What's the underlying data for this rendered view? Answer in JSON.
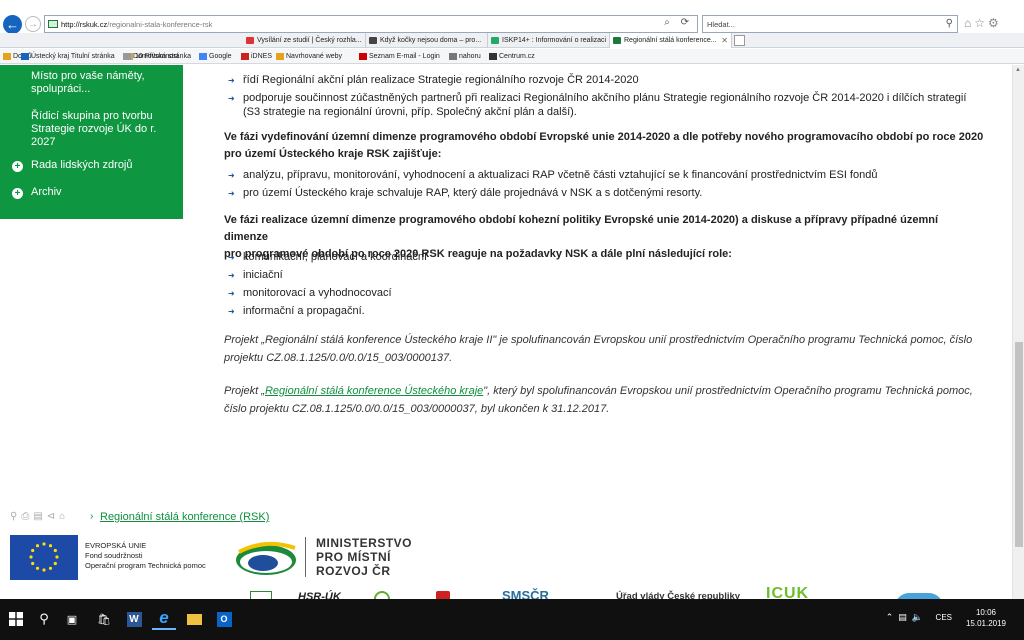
{
  "browser": {
    "url_host": "http://rskuk.cz",
    "url_path": "/regionalni-stala-konference-rsk",
    "search_placeholder": "Hledat...",
    "tabs": [
      {
        "label": "Vysílání ze studií | Český rozhla...",
        "color": "#d33"
      },
      {
        "label": "Když kočky nejsou doma – pro...",
        "color": "#444"
      },
      {
        "label": "ISKP14+ : Informování o realizaci",
        "color": "#2a6"
      },
      {
        "label": "Regionální stálá konference...",
        "color": "#1a7a3c"
      }
    ],
    "favorites": [
      {
        "label": "Domů",
        "color": "#e6a21a"
      },
      {
        "label": "10 Přítomnost",
        "color": "#c9a55a"
      },
      {
        "label": "Ústecký kraj Titulní stránka",
        "color": "#1565c0"
      },
      {
        "label": "Domovská stránka",
        "color": "#999"
      },
      {
        "label": "Google",
        "color": "#4285f4"
      },
      {
        "label": "iDNES",
        "color": "#c22"
      },
      {
        "label": "Navrhované weby",
        "color": "#e6a21a"
      },
      {
        "label": "Seznam E-mail - Login",
        "color": "#c00"
      },
      {
        "label": "nahoru",
        "color": "#777"
      },
      {
        "label": "Centrum.cz",
        "color": "#333"
      }
    ]
  },
  "sidebar": {
    "items": [
      "Místo pro vaše náměty,",
      "spolupráci...",
      "Řídicí skupina pro tvorbu",
      "Strategie rozvoje ÚK do r.",
      "2027",
      "Rada lidských zdrojů",
      "Archiv"
    ]
  },
  "content": {
    "bullets_1": [
      "řídí Regionální akční plán realizace Strategie regionálního rozvoje ČR 2014-2020",
      "podporuje součinnost zúčastněných partnerů při realizaci Regionálního akčního plánu Strategie regionálního rozvoje ČR 2014-2020 i dílčích strategií",
      "(S3 strategie na regionální úrovni, příp. Společný akční plán a další)."
    ],
    "heading_2": [
      "Ve fázi vydefinování územní dimenze programového období Evropské unie 2014-2020 a dle potřeby nového programovacího období po roce 2020",
      "pro území Ústeckého kraje RSK zajišťuje:"
    ],
    "bullets_2": [
      "analýzu, přípravu, monitorování, vyhodnocení a aktualizaci RAP včetně části vztahující se k financování prostřednictvím ESI fondů",
      "pro území Ústeckého kraje schvaluje RAP, který dále projednává v NSK a s dotčenými resorty."
    ],
    "heading_3": [
      "Ve fázi realizace územní dimenze programového období kohezní politiky Evropské unie 2014-2020) a diskuse a přípravy případné územní dimenze",
      "pro programové období po roce 2020 RSK reaguje na požadavky NSK a dále plní následující role:"
    ],
    "bullets_3": [
      "komunikační, plánovací a koordinační",
      "iniciační",
      "monitorovací a vyhodnocovací",
      "informační a propagační."
    ],
    "project_1": [
      "Projekt „Regionální stálá konference Ústeckého kraje II\" je spolufinancován Evropskou unií prostřednictvím Operačního programu Technická pomoc, číslo",
      "projektu CZ.08.1.125/0.0/0.0/15_003/0000137."
    ],
    "project_2_prefix": "Projekt „",
    "project_2_link": "Regionální stálá konference Ústeckého kraje",
    "project_2_suffix": "\", který byl spolufinancován Evropskou unií prostřednictvím Operačního programu Technická pomoc,",
    "project_2_line2": "číslo projektu CZ.08.1.125/0.0/0.0/15_003/0000037,  byl ukončen k 31.12.2017."
  },
  "footer": {
    "breadcrumb": "Regionální stálá konference (RSK)",
    "eu_lines": [
      "EVROPSKÁ UNIE",
      "Fond soudržnosti",
      "Operační program Technická pomoc"
    ],
    "mmr_lines": [
      "MINISTERSTVO",
      "PRO MÍSTNÍ",
      "ROZVOJ ČR"
    ],
    "partner_labels": [
      "HSR-ÚK",
      "SMSČR",
      "Úřad vlády České republiky",
      "ICUK"
    ]
  },
  "taskbar": {
    "time": "10:06",
    "date": "15.01.2019",
    "lang": "CES"
  }
}
